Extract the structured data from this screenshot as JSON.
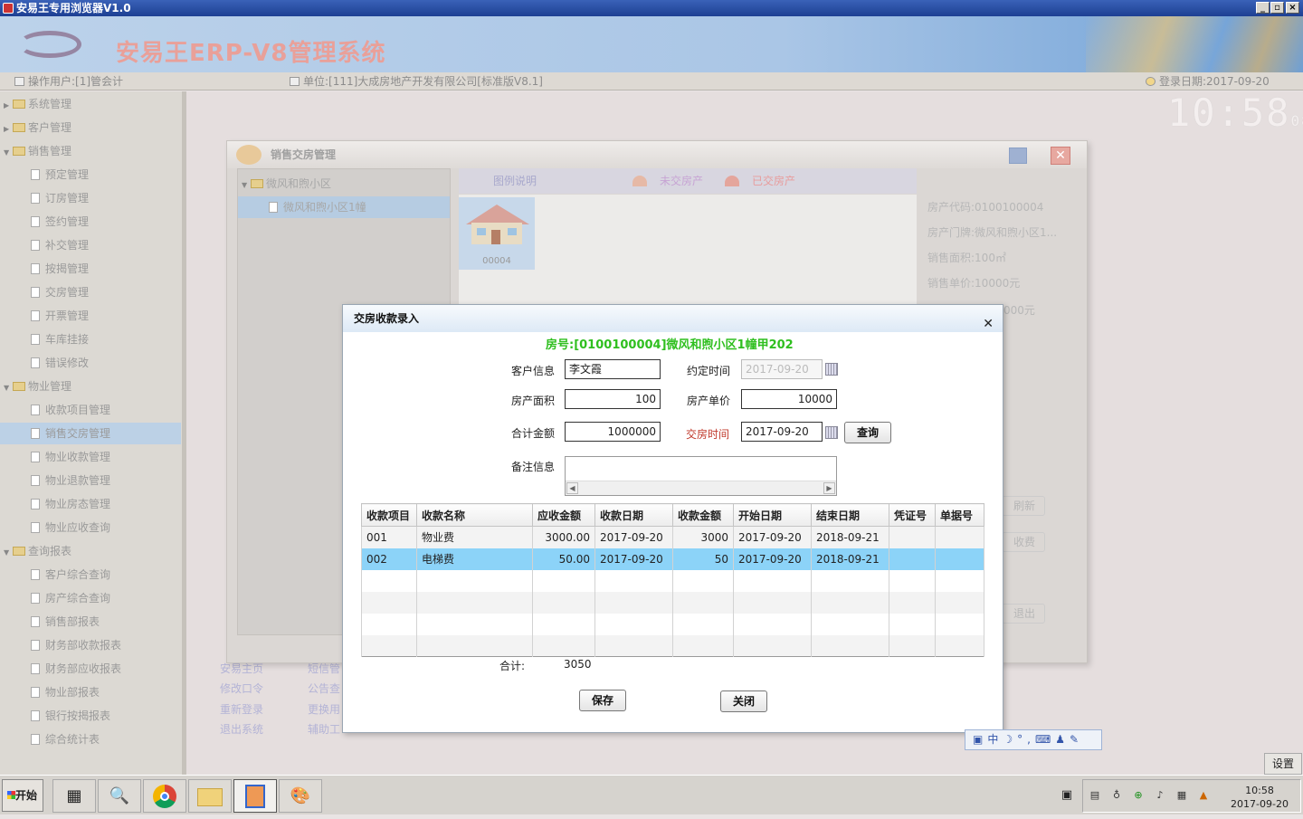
{
  "window": {
    "title": "安易王专用浏览器V1.0",
    "controls": [
      "_",
      "▫",
      "×"
    ]
  },
  "banner": {
    "title": "安易王ERP-V8管理系统"
  },
  "infobar": {
    "user": "操作用户:[1]管会计",
    "unit": "单位:[111]大成房地产开发有限公司[标准版V8.1]",
    "date": "登录日期:2017-09-20"
  },
  "clock": {
    "time": "10:58",
    "seconds": "08"
  },
  "sidebar": {
    "items": [
      {
        "label": "系统管理",
        "type": "folder",
        "expanded": false
      },
      {
        "label": "客户管理",
        "type": "folder",
        "expanded": false
      },
      {
        "label": "销售管理",
        "type": "folder",
        "expanded": true
      },
      {
        "label": "预定管理",
        "type": "page"
      },
      {
        "label": "订房管理",
        "type": "page"
      },
      {
        "label": "签约管理",
        "type": "page"
      },
      {
        "label": "补交管理",
        "type": "page"
      },
      {
        "label": "按揭管理",
        "type": "page"
      },
      {
        "label": "交房管理",
        "type": "page"
      },
      {
        "label": "开票管理",
        "type": "page"
      },
      {
        "label": "车库挂接",
        "type": "page"
      },
      {
        "label": "错误修改",
        "type": "page"
      },
      {
        "label": "物业管理",
        "type": "folder",
        "expanded": true
      },
      {
        "label": "收款项目管理",
        "type": "page"
      },
      {
        "label": "销售交房管理",
        "type": "page",
        "selected": true
      },
      {
        "label": "物业收款管理",
        "type": "page"
      },
      {
        "label": "物业退款管理",
        "type": "page"
      },
      {
        "label": "物业房态管理",
        "type": "page"
      },
      {
        "label": "物业应收查询",
        "type": "page"
      },
      {
        "label": "查询报表",
        "type": "folder",
        "expanded": true
      },
      {
        "label": "客户综合查询",
        "type": "page"
      },
      {
        "label": "房产综合查询",
        "type": "page"
      },
      {
        "label": "销售部报表",
        "type": "page"
      },
      {
        "label": "财务部收款报表",
        "type": "page"
      },
      {
        "label": "财务部应收报表",
        "type": "page"
      },
      {
        "label": "物业部报表",
        "type": "page"
      },
      {
        "label": "银行按揭报表",
        "type": "page"
      },
      {
        "label": "综合统计表",
        "type": "page"
      }
    ]
  },
  "desktop_links": {
    "col1": [
      "安易主页",
      "修改口令",
      "重新登录",
      "退出系统"
    ],
    "col2": [
      "短信管",
      "公告查",
      "更换用",
      "辅助工"
    ]
  },
  "bg_window": {
    "title": "销售交房管理",
    "tree": {
      "root": "微风和煦小区",
      "child": "微风和煦小区1幢"
    },
    "legend": {
      "title": "图例说明",
      "unsold": "未交房产",
      "sold": "已交房产"
    },
    "house_code": "00004",
    "details": [
      "房产代码:0100100004",
      "房产门牌:微风和煦小区1...",
      "销售面积:100㎡",
      "销售单价:10000元",
      "000元"
    ],
    "side_buttons": [
      "刷新",
      "收费",
      "退出"
    ]
  },
  "dialog": {
    "title": "交房收款录入",
    "room_header": "房号:[0100100004]微风和煦小区1幢甲202",
    "fields": {
      "customer_label": "客户信息",
      "customer": "李文霞",
      "agreed_time_label": "约定时间",
      "agreed_time": "2017-09-20",
      "area_label": "房产面积",
      "area": "100",
      "unit_price_label": "房产单价",
      "unit_price": "10000",
      "total_label": "合计金额",
      "total": "1000000",
      "handover_time_label": "交房时间",
      "handover_time": "2017-09-20",
      "remarks_label": "备注信息",
      "remarks": ""
    },
    "query_button": "查询",
    "table": {
      "columns": [
        "收款项目",
        "收款名称",
        "应收金额",
        "收款日期",
        "收款金额",
        "开始日期",
        "结束日期",
        "凭证号",
        "单据号"
      ],
      "rows": [
        [
          "001",
          "物业费",
          "3000.00",
          "2017-09-20",
          "3000",
          "2017-09-20",
          "2018-09-21",
          "",
          ""
        ],
        [
          "002",
          "电梯费",
          "50.00",
          "2017-09-20",
          "50",
          "2017-09-20",
          "2018-09-21",
          "",
          ""
        ]
      ],
      "selected_row": 1
    },
    "sum_label": "合计:",
    "sum_value": "3050",
    "save_button": "保存",
    "close_button": "关闭"
  },
  "ime_bar": {
    "text": "中"
  },
  "settings_button": "设置",
  "taskbar": {
    "start": "开始",
    "time": "10:58",
    "date": "2017-09-20"
  },
  "colors": {
    "room_header": "#2fbf1f",
    "highlight_label": "#c0392b",
    "selected_row": "#8cd3f8"
  }
}
